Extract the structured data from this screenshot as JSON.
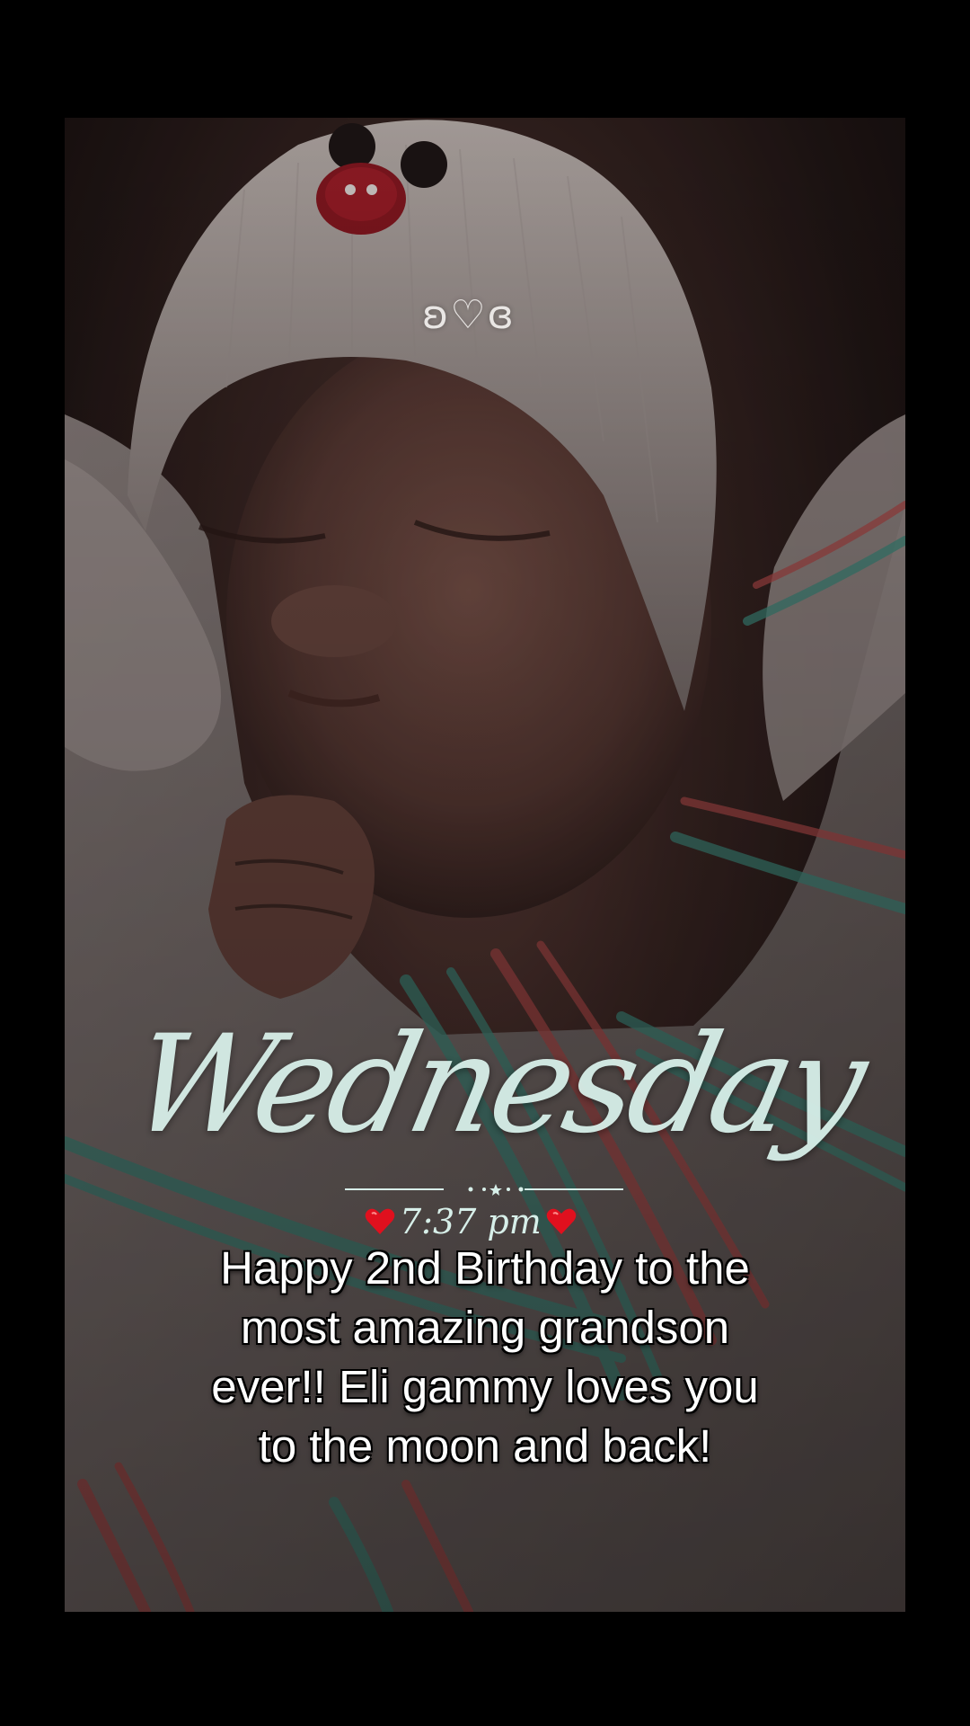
{
  "overlay": {
    "sticker_hearts": "ʚ♡ɞ",
    "script_day": "Wednesday",
    "time": "7:37 pm"
  },
  "caption": {
    "lines": [
      "Happy 2nd Birthday to the",
      "most amazing grandson",
      "ever!! Eli gammy loves you",
      "to the moon and back!"
    ]
  },
  "colors": {
    "background": "#000000",
    "script_text": "#d7efe9",
    "heart": "#e0101e",
    "caption_text": "#ffffff"
  },
  "icons": {
    "heart": "heart-icon",
    "mouse_ears_button": "mouse-ears-icon"
  }
}
